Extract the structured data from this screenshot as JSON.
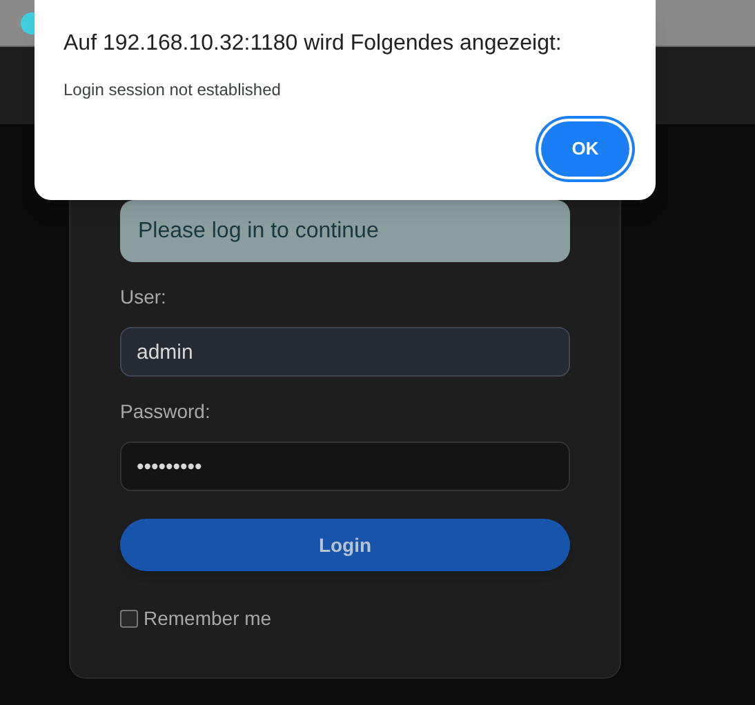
{
  "dialog": {
    "title": "Auf 192.168.10.32:1180 wird Folgendes angezeigt:",
    "message": "Login session not established",
    "button": "OK"
  },
  "login": {
    "alert": "Please log in to continue",
    "fields": [
      {
        "label": "User:",
        "value": "admin",
        "kind": "text"
      },
      {
        "label": "Password:",
        "value": "•••••••••",
        "kind": "password"
      }
    ],
    "button": "Login",
    "remember": {
      "label": "Remember me",
      "checked": false
    }
  }
}
